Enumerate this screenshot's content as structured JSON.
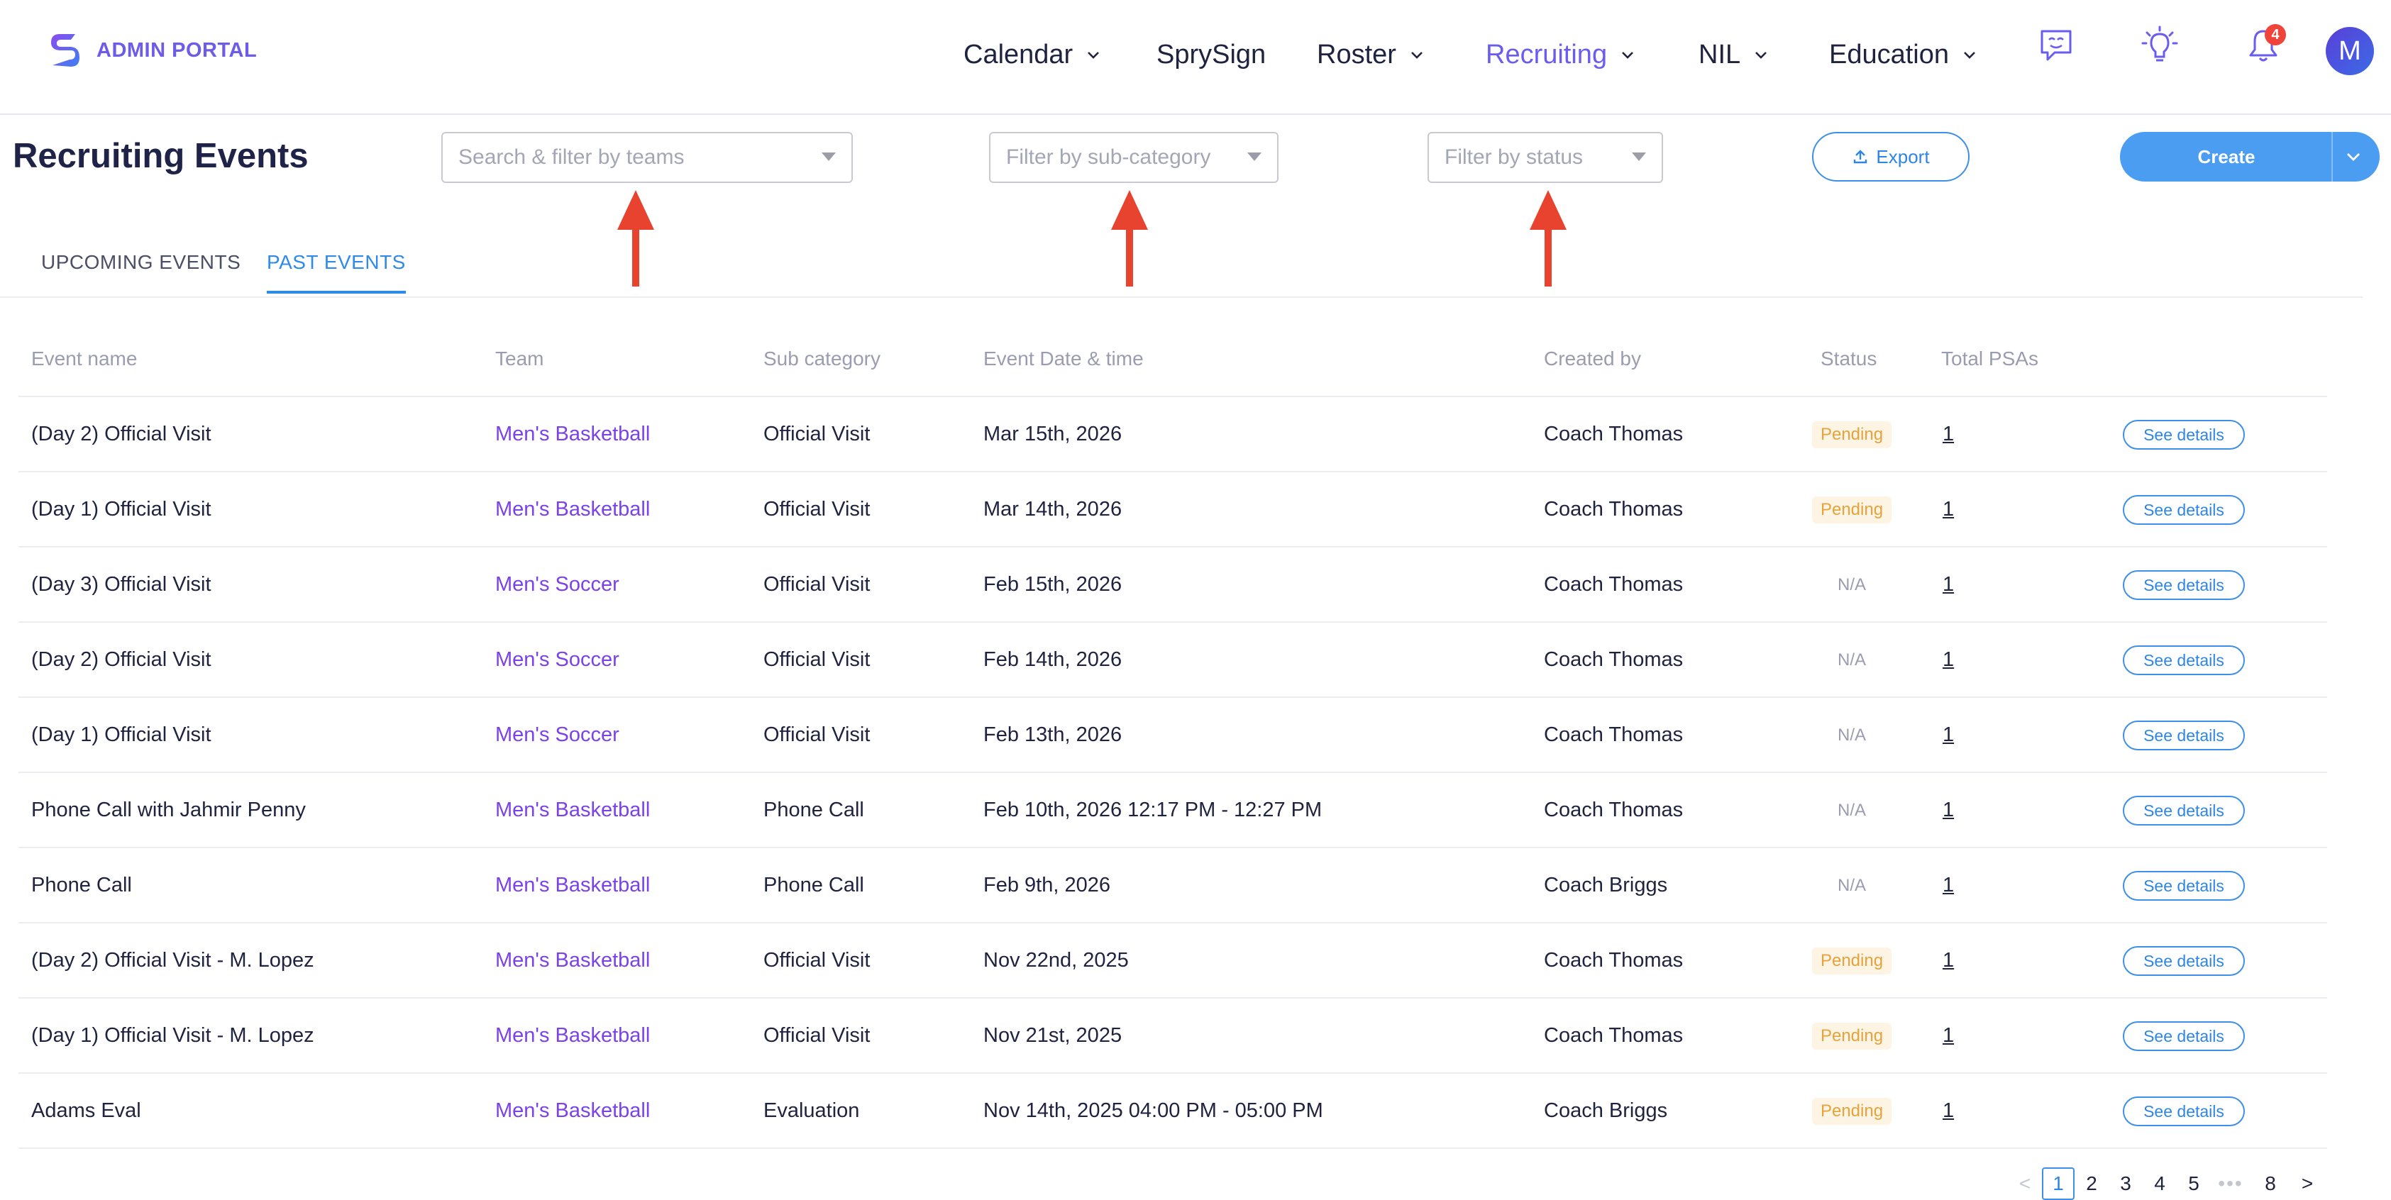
{
  "app": {
    "logo_text": "ADMIN PORTAL",
    "brand_colors": {
      "primary": "#6a5cf0",
      "link": "#2f8ae8",
      "team": "#7a42e8",
      "alert": "#f0443a"
    }
  },
  "nav": {
    "items": [
      {
        "label": "Calendar",
        "has_dropdown": true,
        "active": false
      },
      {
        "label": "SprySign",
        "has_dropdown": false,
        "active": false
      },
      {
        "label": "Roster",
        "has_dropdown": true,
        "active": false
      },
      {
        "label": "Recruiting",
        "has_dropdown": true,
        "active": true
      },
      {
        "label": "NIL",
        "has_dropdown": true,
        "active": false
      },
      {
        "label": "Education",
        "has_dropdown": true,
        "active": false
      }
    ],
    "icons": [
      "chat-feedback-icon",
      "lightbulb-icon",
      "bell-icon"
    ],
    "notification_count": "4",
    "avatar_initial": "M"
  },
  "toolbar": {
    "title": "Recruiting Events",
    "team_filter_placeholder": "Search & filter by teams",
    "subcategory_filter_placeholder": "Filter by sub-category",
    "status_filter_placeholder": "Filter by status",
    "export_label": "Export",
    "create_label": "Create"
  },
  "tabs": [
    {
      "label": "UPCOMING EVENTS",
      "active": false
    },
    {
      "label": "PAST EVENTS",
      "active": true
    }
  ],
  "table": {
    "columns": [
      "Event name",
      "Team",
      "Sub category",
      "Event Date & time",
      "Created by",
      "Status",
      "Total PSAs"
    ],
    "action_label": "See details",
    "rows": [
      {
        "name": "(Day 2) Official Visit",
        "team": "Men's Basketball",
        "sub": "Official Visit",
        "date": "Mar 15th, 2026",
        "creator": "Coach Thomas",
        "status": "Pending",
        "psas": "1"
      },
      {
        "name": "(Day 1) Official Visit",
        "team": "Men's Basketball",
        "sub": "Official Visit",
        "date": "Mar 14th, 2026",
        "creator": "Coach Thomas",
        "status": "Pending",
        "psas": "1"
      },
      {
        "name": "(Day 3) Official Visit",
        "team": "Men's Soccer",
        "sub": "Official Visit",
        "date": "Feb 15th, 2026",
        "creator": "Coach Thomas",
        "status": "N/A",
        "psas": "1"
      },
      {
        "name": "(Day 2) Official Visit",
        "team": "Men's Soccer",
        "sub": "Official Visit",
        "date": "Feb 14th, 2026",
        "creator": "Coach Thomas",
        "status": "N/A",
        "psas": "1"
      },
      {
        "name": "(Day 1) Official Visit",
        "team": "Men's Soccer",
        "sub": "Official Visit",
        "date": "Feb 13th, 2026",
        "creator": "Coach Thomas",
        "status": "N/A",
        "psas": "1"
      },
      {
        "name": "Phone Call with Jahmir Penny",
        "team": "Men's Basketball",
        "sub": "Phone Call",
        "date": "Feb 10th, 2026 12:17 PM - 12:27 PM",
        "creator": "Coach Thomas",
        "status": "N/A",
        "psas": "1"
      },
      {
        "name": "Phone Call",
        "team": "Men's Basketball",
        "sub": "Phone Call",
        "date": "Feb 9th, 2026",
        "creator": "Coach Briggs",
        "status": "N/A",
        "psas": "1"
      },
      {
        "name": "(Day 2) Official Visit - M. Lopez",
        "team": "Men's Basketball",
        "sub": "Official Visit",
        "date": "Nov 22nd, 2025",
        "creator": "Coach Thomas",
        "status": "Pending",
        "psas": "1"
      },
      {
        "name": "(Day 1) Official Visit - M. Lopez",
        "team": "Men's Basketball",
        "sub": "Official Visit",
        "date": "Nov 21st, 2025",
        "creator": "Coach Thomas",
        "status": "Pending",
        "psas": "1"
      },
      {
        "name": "Adams Eval",
        "team": "Men's Basketball",
        "sub": "Evaluation",
        "date": "Nov 14th, 2025 04:00 PM - 05:00 PM",
        "creator": "Coach Briggs",
        "status": "Pending",
        "psas": "1"
      }
    ]
  },
  "pagination": {
    "prev": "<",
    "pages": [
      "1",
      "2",
      "3",
      "4",
      "5"
    ],
    "ellipsis": "•••",
    "last": "8",
    "next": ">",
    "current": "1"
  }
}
